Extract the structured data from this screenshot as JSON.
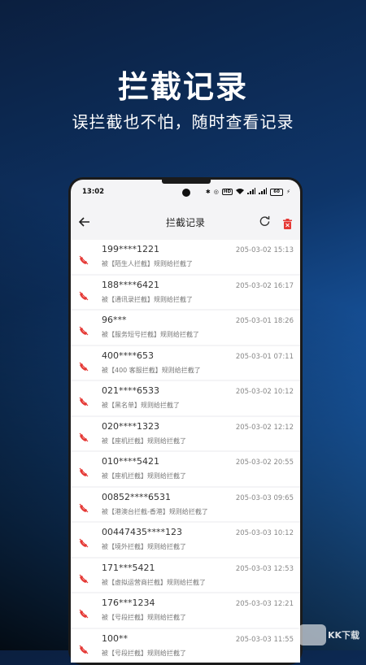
{
  "hero": {
    "title": "拦截记录",
    "subtitle": "误拦截也不怕，随时查看记录"
  },
  "status_bar": {
    "time": "13:02",
    "icons": [
      "bluetooth-icon",
      "nfc-icon",
      "hd-icon",
      "wifi-icon",
      "signal-icon",
      "signal-icon",
      "battery-icon",
      "charging-icon"
    ],
    "hd_label": "HD",
    "battery_level": "60"
  },
  "appbar": {
    "title": "拦截记录",
    "back_icon": "arrow-left-icon",
    "refresh_icon": "refresh-icon",
    "delete_icon": "trash-icon",
    "delete_color": "#e53935"
  },
  "records": [
    {
      "number": "199****1221",
      "time": "205-03-02 15:13",
      "reason": "被【陌生人拦截】规则给拦截了"
    },
    {
      "number": "188****6421",
      "time": "205-03-02 16:17",
      "reason": "被【通讯录拦截】规则给拦截了"
    },
    {
      "number": "96***",
      "time": "205-03-01 18:26",
      "reason": "被【服务短号拦截】规则给拦截了"
    },
    {
      "number": "400****653",
      "time": "205-03-01 07:11",
      "reason": "被【400 客服拦截】规则给拦截了"
    },
    {
      "number": "021****6533",
      "time": "205-03-02 10:12",
      "reason": "被【黑名单】规则给拦截了"
    },
    {
      "number": "020****1323",
      "time": "205-03-02 12:12",
      "reason": "被【座机拦截】规则给拦截了"
    },
    {
      "number": "010****5421",
      "time": "205-03-02 20:55",
      "reason": "被【座机拦截】规则给拦截了"
    },
    {
      "number": "00852****6531",
      "time": "205-03-03 09:65",
      "reason": "被【港澳台拦截-香港】规则给拦截了"
    },
    {
      "number": "00447435****123",
      "time": "205-03-03 10:12",
      "reason": "被【境外拦截】规则给拦截了"
    },
    {
      "number": "171***5421",
      "time": "205-03-03 12:53",
      "reason": "被【虚拟运营商拦截】规则给拦截了"
    },
    {
      "number": "176***1234",
      "time": "205-03-03 12:21",
      "reason": "被【号段拦截】规则给拦截了"
    },
    {
      "number": "100**",
      "time": "205-03-03 11:55",
      "reason": "被【号段拦截】规则给拦截了"
    }
  ],
  "record_icon": "missed-call-blocked-icon",
  "record_icon_color": "#e53935",
  "watermark": {
    "text": "KK下载"
  }
}
